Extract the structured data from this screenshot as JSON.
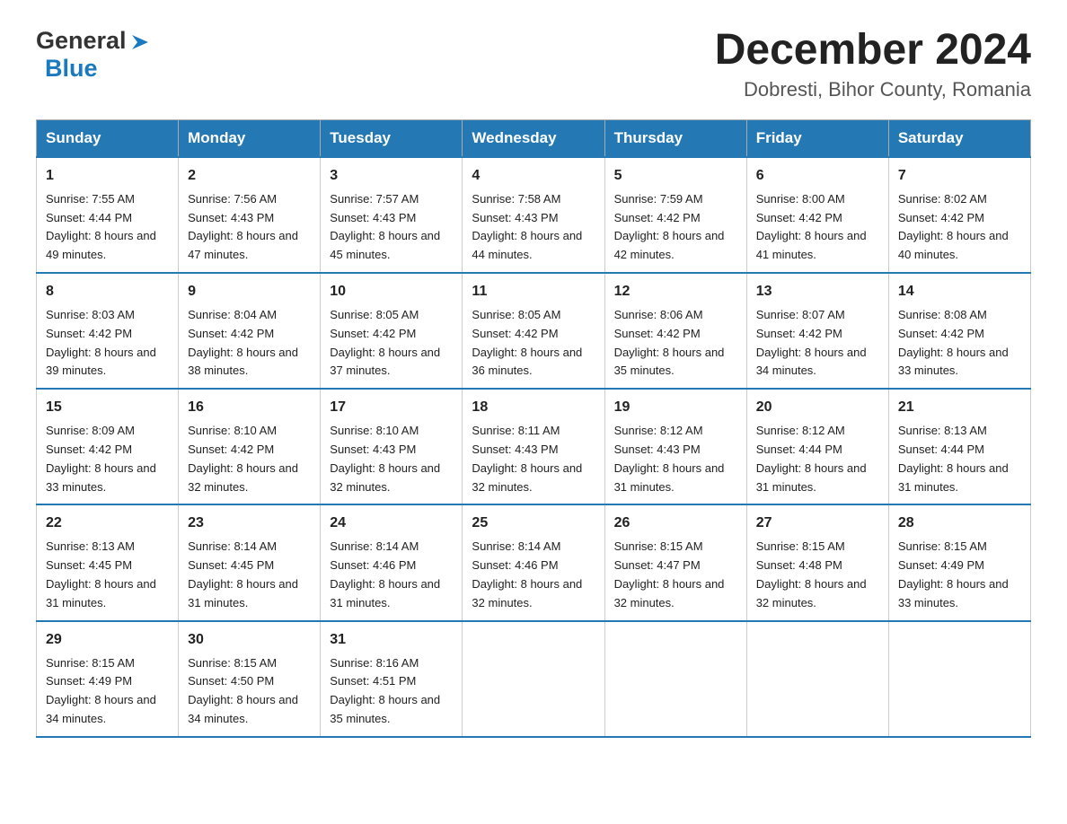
{
  "header": {
    "logo_general": "General",
    "logo_blue": "Blue",
    "calendar_title": "December 2024",
    "calendar_subtitle": "Dobresti, Bihor County, Romania"
  },
  "weekdays": [
    "Sunday",
    "Monday",
    "Tuesday",
    "Wednesday",
    "Thursday",
    "Friday",
    "Saturday"
  ],
  "weeks": [
    [
      {
        "day": "1",
        "sunrise": "7:55 AM",
        "sunset": "4:44 PM",
        "daylight": "8 hours and 49 minutes."
      },
      {
        "day": "2",
        "sunrise": "7:56 AM",
        "sunset": "4:43 PM",
        "daylight": "8 hours and 47 minutes."
      },
      {
        "day": "3",
        "sunrise": "7:57 AM",
        "sunset": "4:43 PM",
        "daylight": "8 hours and 45 minutes."
      },
      {
        "day": "4",
        "sunrise": "7:58 AM",
        "sunset": "4:43 PM",
        "daylight": "8 hours and 44 minutes."
      },
      {
        "day": "5",
        "sunrise": "7:59 AM",
        "sunset": "4:42 PM",
        "daylight": "8 hours and 42 minutes."
      },
      {
        "day": "6",
        "sunrise": "8:00 AM",
        "sunset": "4:42 PM",
        "daylight": "8 hours and 41 minutes."
      },
      {
        "day": "7",
        "sunrise": "8:02 AM",
        "sunset": "4:42 PM",
        "daylight": "8 hours and 40 minutes."
      }
    ],
    [
      {
        "day": "8",
        "sunrise": "8:03 AM",
        "sunset": "4:42 PM",
        "daylight": "8 hours and 39 minutes."
      },
      {
        "day": "9",
        "sunrise": "8:04 AM",
        "sunset": "4:42 PM",
        "daylight": "8 hours and 38 minutes."
      },
      {
        "day": "10",
        "sunrise": "8:05 AM",
        "sunset": "4:42 PM",
        "daylight": "8 hours and 37 minutes."
      },
      {
        "day": "11",
        "sunrise": "8:05 AM",
        "sunset": "4:42 PM",
        "daylight": "8 hours and 36 minutes."
      },
      {
        "day": "12",
        "sunrise": "8:06 AM",
        "sunset": "4:42 PM",
        "daylight": "8 hours and 35 minutes."
      },
      {
        "day": "13",
        "sunrise": "8:07 AM",
        "sunset": "4:42 PM",
        "daylight": "8 hours and 34 minutes."
      },
      {
        "day": "14",
        "sunrise": "8:08 AM",
        "sunset": "4:42 PM",
        "daylight": "8 hours and 33 minutes."
      }
    ],
    [
      {
        "day": "15",
        "sunrise": "8:09 AM",
        "sunset": "4:42 PM",
        "daylight": "8 hours and 33 minutes."
      },
      {
        "day": "16",
        "sunrise": "8:10 AM",
        "sunset": "4:42 PM",
        "daylight": "8 hours and 32 minutes."
      },
      {
        "day": "17",
        "sunrise": "8:10 AM",
        "sunset": "4:43 PM",
        "daylight": "8 hours and 32 minutes."
      },
      {
        "day": "18",
        "sunrise": "8:11 AM",
        "sunset": "4:43 PM",
        "daylight": "8 hours and 32 minutes."
      },
      {
        "day": "19",
        "sunrise": "8:12 AM",
        "sunset": "4:43 PM",
        "daylight": "8 hours and 31 minutes."
      },
      {
        "day": "20",
        "sunrise": "8:12 AM",
        "sunset": "4:44 PM",
        "daylight": "8 hours and 31 minutes."
      },
      {
        "day": "21",
        "sunrise": "8:13 AM",
        "sunset": "4:44 PM",
        "daylight": "8 hours and 31 minutes."
      }
    ],
    [
      {
        "day": "22",
        "sunrise": "8:13 AM",
        "sunset": "4:45 PM",
        "daylight": "8 hours and 31 minutes."
      },
      {
        "day": "23",
        "sunrise": "8:14 AM",
        "sunset": "4:45 PM",
        "daylight": "8 hours and 31 minutes."
      },
      {
        "day": "24",
        "sunrise": "8:14 AM",
        "sunset": "4:46 PM",
        "daylight": "8 hours and 31 minutes."
      },
      {
        "day": "25",
        "sunrise": "8:14 AM",
        "sunset": "4:46 PM",
        "daylight": "8 hours and 32 minutes."
      },
      {
        "day": "26",
        "sunrise": "8:15 AM",
        "sunset": "4:47 PM",
        "daylight": "8 hours and 32 minutes."
      },
      {
        "day": "27",
        "sunrise": "8:15 AM",
        "sunset": "4:48 PM",
        "daylight": "8 hours and 32 minutes."
      },
      {
        "day": "28",
        "sunrise": "8:15 AM",
        "sunset": "4:49 PM",
        "daylight": "8 hours and 33 minutes."
      }
    ],
    [
      {
        "day": "29",
        "sunrise": "8:15 AM",
        "sunset": "4:49 PM",
        "daylight": "8 hours and 34 minutes."
      },
      {
        "day": "30",
        "sunrise": "8:15 AM",
        "sunset": "4:50 PM",
        "daylight": "8 hours and 34 minutes."
      },
      {
        "day": "31",
        "sunrise": "8:16 AM",
        "sunset": "4:51 PM",
        "daylight": "8 hours and 35 minutes."
      },
      null,
      null,
      null,
      null
    ]
  ],
  "labels": {
    "sunrise": "Sunrise: ",
    "sunset": "Sunset: ",
    "daylight": "Daylight: "
  }
}
